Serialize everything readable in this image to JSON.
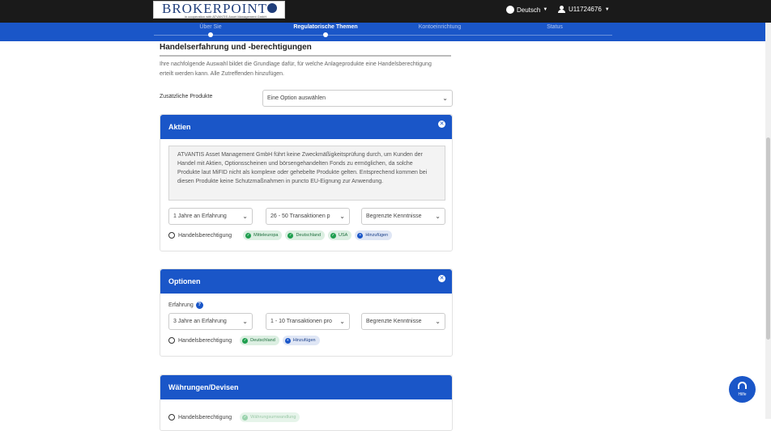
{
  "header": {
    "logo": {
      "title": "BROKERPOINT",
      "subtitle": "in cooperation with ATVANTIS Asset Management GmbH"
    },
    "language": "Deutsch",
    "user": "U11724676"
  },
  "steps": [
    {
      "label": "Über Sie",
      "active": false
    },
    {
      "label": "Regulatorische Themen",
      "active": true
    },
    {
      "label": "Kontoeinrichtung",
      "active": false
    },
    {
      "label": "Status",
      "active": false
    }
  ],
  "section": {
    "title": "Handelserfahrung und -berechtigungen",
    "intro": "Ihre nachfolgende Auswahl bildet die Grundlage dafür, für welche Anlageprodukte eine Handelsberechtigung erteilt werden kann. Alle Zutreffenden hinzufügen.",
    "extra_products_label": "Zusätzliche Produkte",
    "extra_products_select": "Eine Option auswählen"
  },
  "cards": {
    "aktien": {
      "title": "Aktien",
      "notice": "ATVANTIS Asset Management GmbH führt keine Zweckmäßigkeitsprüfung durch, um Kunden der Handel mit Aktien, Optionsscheinen und börsengehandelten Fonds zu ermöglichen, da solche Produkte laut MiFID nicht als komplexe oder gehebelte Produkte gelten. Entsprechend kommen bei diesen Produkte keine Schutzmaßnahmen in puncto EU-Eignung zur Anwendung.",
      "experience": "1 Jahre an Erfahrung",
      "transactions": "26 - 50 Transaktionen p",
      "knowledge": "Begrenzte Kenntnisse",
      "permission_label": "Handelsberechtigung",
      "chips": [
        "Mitteleuropa",
        "Deutschland",
        "USA"
      ],
      "add_label": "Hinzufügen"
    },
    "optionen": {
      "title": "Optionen",
      "experience_label": "Erfahrung",
      "experience": "3 Jahre an Erfahrung",
      "transactions": "1 - 10 Transaktionen pro",
      "knowledge": "Begrenzte Kenntnisse",
      "permission_label": "Handelsberechtigung",
      "chips": [
        "Deutschland"
      ],
      "add_label": "Hinzufügen"
    },
    "devisen": {
      "title": "Währungen/Devisen",
      "permission_label": "Handelsberechtigung",
      "chip": "Währungsumwandlung"
    }
  },
  "help_button": "Hilfe",
  "colors": {
    "primary": "#1a56c8",
    "topbar": "#1a1a1a",
    "chip_green": "#1e9e4e"
  }
}
